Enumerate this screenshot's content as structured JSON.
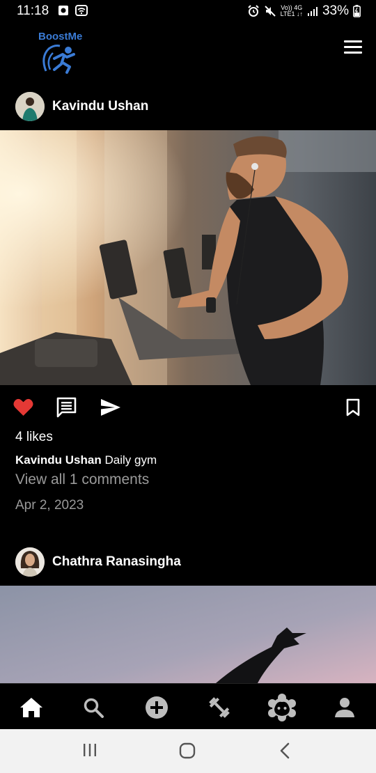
{
  "status_bar": {
    "time": "11:18",
    "network_top": "Vo)) 4G",
    "network_bottom": "LTE1 ↓↑",
    "battery": "33%"
  },
  "header": {
    "app_name": "BoostMe"
  },
  "posts": [
    {
      "username": "Kavindu Ushan",
      "likes": "4 likes",
      "caption_user": "Kavindu Ushan",
      "caption_text": "Daily gym",
      "comments_link": "View all 1 comments",
      "date": "Apr 2, 2023",
      "liked": true
    },
    {
      "username": "Chathra Ranasingha"
    }
  ],
  "bottom_nav": [
    {
      "icon": "home-icon"
    },
    {
      "icon": "search-icon"
    },
    {
      "icon": "add-circle-icon"
    },
    {
      "icon": "dumbbell-icon"
    },
    {
      "icon": "face-icon"
    },
    {
      "icon": "profile-icon"
    }
  ],
  "colors": {
    "accent": "#3a7bd5",
    "like": "#e53935",
    "muted_text": "#9a9a9a"
  }
}
